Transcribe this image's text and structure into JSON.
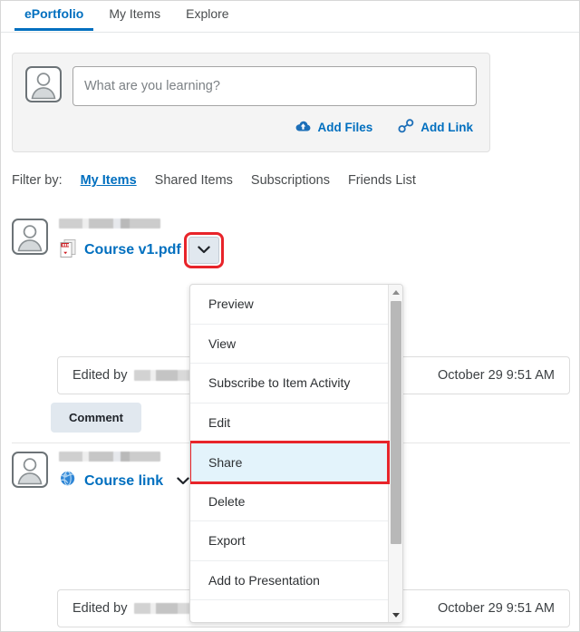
{
  "tabs": [
    {
      "label": "ePortfolio",
      "active": true
    },
    {
      "label": "My Items",
      "active": false
    },
    {
      "label": "Explore",
      "active": false
    }
  ],
  "composer": {
    "placeholder": "What are you learning?",
    "value": "",
    "add_files_label": "Add Files",
    "add_link_label": "Add Link",
    "add_files_icon": "cloud-upload-icon",
    "add_link_icon": "link-icon",
    "avatar_icon": "user-avatar-icon"
  },
  "filter": {
    "label": "Filter by:",
    "options": [
      {
        "label": "My Items",
        "active": true
      },
      {
        "label": "Shared Items",
        "active": false
      },
      {
        "label": "Subscriptions",
        "active": false
      },
      {
        "label": "Friends List",
        "active": false
      }
    ]
  },
  "items": [
    {
      "title": "Course v1.pdf",
      "type_icon": "pdf-file-icon",
      "avatar_icon": "user-avatar-icon",
      "chevron_icon": "chevron-down-icon",
      "edited_label": "Edited by",
      "timestamp": "October 29 9:51 AM",
      "comment_label": "Comment"
    },
    {
      "title": "Course link",
      "type_icon": "globe-link-icon",
      "avatar_icon": "user-avatar-icon",
      "chevron_icon": "chevron-down-icon",
      "edited_label": "Edited by",
      "timestamp": "October 29 9:51 AM"
    }
  ],
  "menu": {
    "items": [
      {
        "label": "Preview",
        "selected": false
      },
      {
        "label": "View",
        "selected": false
      },
      {
        "label": "Subscribe to Item Activity",
        "selected": false
      },
      {
        "label": "Edit",
        "selected": false
      },
      {
        "label": "Share",
        "selected": true
      },
      {
        "label": "Delete",
        "selected": false
      },
      {
        "label": "Export",
        "selected": false
      },
      {
        "label": "Add to Presentation",
        "selected": false
      }
    ],
    "scroll_up_icon": "scroll-up-arrow-icon",
    "scroll_down_icon": "scroll-down-arrow-icon"
  },
  "colors": {
    "accent": "#006fbf",
    "highlight_outline": "#e8242a",
    "selected_bg": "#e3f3fb",
    "button_bg": "#e1e8ef"
  }
}
